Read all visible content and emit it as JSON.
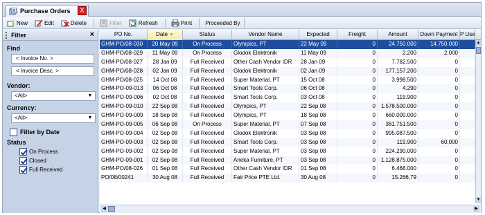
{
  "tab": {
    "title": "Purchase Orders",
    "close": "X"
  },
  "toolbar": {
    "new": "New",
    "edit": "Edit",
    "delete": "Delete",
    "filter": "Filter",
    "refresh": "Refresh",
    "print": "Print",
    "proceeded_by": "Proceeded By"
  },
  "filter": {
    "title": "Filter",
    "close": "×",
    "find_label": "Find",
    "invoice_no_placeholder": "< Invoice No. >",
    "invoice_desc_placeholder": "< Invoice Desc. >",
    "vendor_label": "Vendor:",
    "vendor_value": "<All>",
    "currency_label": "Currency:",
    "currency_value": "<All>",
    "filter_by_date": "Filter by Date",
    "status_label": "Status",
    "status_items": [
      {
        "label": "On Process",
        "checked": true
      },
      {
        "label": "Closed",
        "checked": true
      },
      {
        "label": "Full Received",
        "checked": true
      }
    ]
  },
  "grid": {
    "columns": [
      "PO No.",
      "Date",
      "Status",
      "Vendor Name",
      "Expected",
      "Freight",
      "Amount",
      "Down Payment",
      "P Use"
    ],
    "sorted_column": "Date",
    "selected_row": 0,
    "rows": [
      [
        "GHM-PO/08-030",
        "20 May 09",
        "On Process",
        "Olympics, PT",
        "22 May 09",
        "0",
        "24.750.000",
        "14.750.000",
        ""
      ],
      [
        "GHM-PO/08-029",
        "11 May 09",
        "On Process",
        "Glodok Elektronik",
        "11 May 09",
        "0",
        "2.200",
        "2.000",
        ""
      ],
      [
        "GHM-PO/08-027",
        "28 Jan 09",
        "Full Received",
        "Other Cash Vendor IDR",
        "28 Jan 09",
        "0",
        "7.782.500",
        "0",
        ""
      ],
      [
        "GHM-PO/08-028",
        "02 Jan 09",
        "Full Received",
        "Glodok Elektronik",
        "02 Jan 09",
        "0",
        "177.157.200",
        "0",
        ""
      ],
      [
        "GHM-PO/08-025",
        "14 Oct 08",
        "Full Received",
        "Super Material, PT",
        "15 Oct 08",
        "0",
        "3.998.500",
        "0",
        ""
      ],
      [
        "GHM-PO-09-013",
        "06 Oct 08",
        "Full Received",
        "Smart Tools Corp.",
        "06 Oct 08",
        "0",
        "4.290",
        "0",
        ""
      ],
      [
        "GHM-PO-09-006",
        "02 Oct 08",
        "Full Received",
        "Smart Tools Corp.",
        "03 Oct 08",
        "0",
        "119.900",
        "0",
        ""
      ],
      [
        "GHM-PO-09-010",
        "22 Sep 08",
        "Full Received",
        "Olympics, PT",
        "22 Sep 08",
        "0",
        "1.578.500.000",
        "0",
        ""
      ],
      [
        "GHM-PO-09-009",
        "18 Sep 08",
        "Full Received",
        "Olympics, PT",
        "18 Sep 08",
        "0",
        "660.000.000",
        "0",
        ""
      ],
      [
        "GHM-PO-09-005",
        "06 Sep 08",
        "On Process",
        "Super Material, PT",
        "07 Sep 08",
        "0",
        "361.751.500",
        "0",
        ""
      ],
      [
        "GHM-PO-09-004",
        "02 Sep 08",
        "Full Received",
        "Glodok Elektronik",
        "03 Sep 08",
        "0",
        "995.087.500",
        "0",
        ""
      ],
      [
        "GHM-PO-09-003",
        "02 Sep 08",
        "Full Received",
        "Smart Tools Corp.",
        "03 Sep 08",
        "0",
        "119.900",
        "60.000",
        ""
      ],
      [
        "GHM-PO-09-002",
        "02 Sep 08",
        "Full Received",
        "Super Material, PT",
        "03 Sep 08",
        "0",
        "224.290.000",
        "0",
        ""
      ],
      [
        "GHM-PO-09-001",
        "02 Sep 08",
        "Full Received",
        "Aneka Furniture, PT",
        "03 Sep 08",
        "0",
        "1.128.875.000",
        "0",
        ""
      ],
      [
        "GHM-PO/08-026",
        "01 Sep 08",
        "Full Received",
        "Other Cash Vendor IDR",
        "01 Sep 08",
        "0",
        "6.468.000",
        "0",
        ""
      ],
      [
        "PO/08/00241",
        "30 Aug 08",
        "Full Received",
        "Fair Price PTE Ltd.",
        "30 Aug 08",
        "0",
        "15.266,79",
        "0",
        ""
      ]
    ]
  },
  "colors": {
    "selection": "#1f4e9e",
    "close_red": "#d42020",
    "sort_arrow": "#d4a000"
  }
}
